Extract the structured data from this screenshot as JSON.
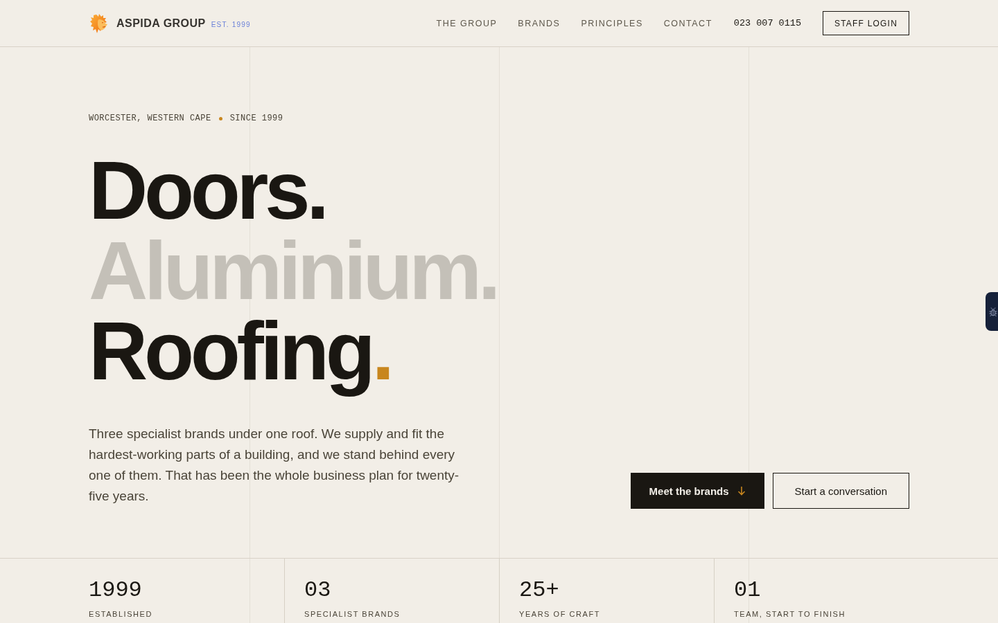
{
  "header": {
    "brand": "ASPIDA GROUP",
    "established": "EST. 1999",
    "nav": [
      "THE GROUP",
      "BRANDS",
      "PRINCIPLES",
      "CONTACT"
    ],
    "phone": "023 007 0115",
    "login_button": "STAFF LOGIN"
  },
  "hero": {
    "eyebrow": [
      "WORCESTER, WESTERN CAPE",
      "SINCE 1999"
    ],
    "headline": [
      {
        "text": "Doors.",
        "muted": false
      },
      {
        "text": "Aluminium.",
        "muted": true
      },
      {
        "text": "Roofing",
        "muted": false,
        "accent_mark": "."
      }
    ],
    "intro": "Three specialist brands under one roof. We supply and fit the hardest-working parts of a building, and we stand behind every one of them. That has been the whole business plan for twenty-five years.",
    "buttons": [
      {
        "label": "Meet the brands",
        "kind": "primary"
      },
      {
        "label": "Start a conversation",
        "kind": "secondary"
      }
    ]
  },
  "stats": [
    {
      "value": "1999",
      "label": "ESTABLISHED"
    },
    {
      "value": "03",
      "label": "SPECIALIST BRANDS"
    },
    {
      "value": "25+",
      "label": "YEARS OF CRAFT"
    },
    {
      "value": "01",
      "label": "TEAM, START TO FINISH"
    }
  ]
}
